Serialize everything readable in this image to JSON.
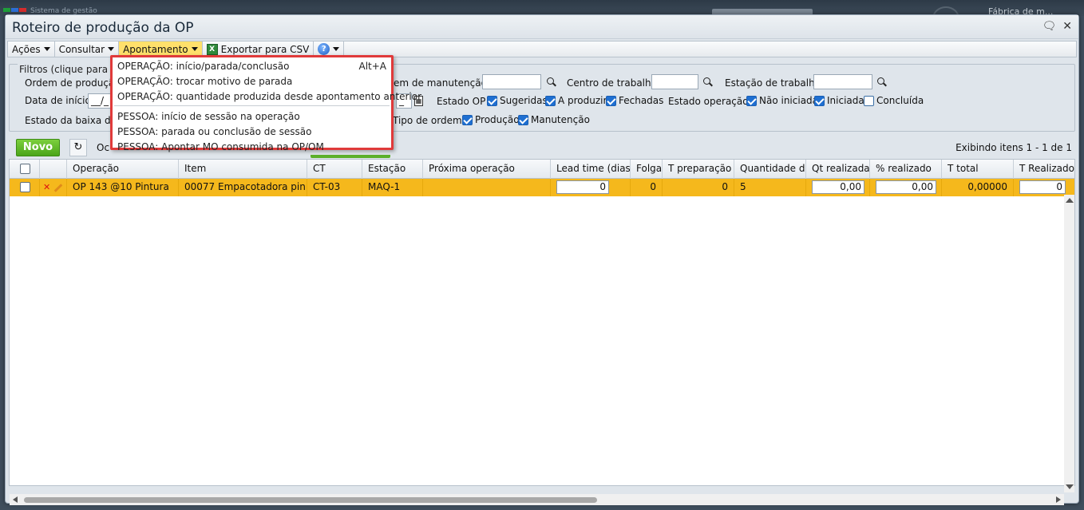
{
  "background_app": {
    "title": "Sistema de gestão",
    "right_label": "Fábrica de m...",
    "logo_colors": [
      "#1f9e3a",
      "#2d6fd6",
      "#d62d2d"
    ]
  },
  "window": {
    "title": "Roteiro de produção da OP"
  },
  "toolbar": {
    "acoes": "Ações",
    "consultar": "Consultar",
    "apontamento": "Apontamento",
    "exportar": "Exportar para CSV"
  },
  "menu": {
    "items": [
      {
        "label": "OPERAÇÃO: início/parada/conclusão",
        "shortcut": "Alt+A"
      },
      {
        "label": "OPERAÇÃO: trocar motivo de parada",
        "shortcut": ""
      },
      {
        "label": "OPERAÇÃO: quantidade produzida desde apontamento anterior",
        "shortcut": ""
      },
      {
        "label": "PESSOA: início de sessão na operação",
        "shortcut": ""
      },
      {
        "label": "PESSOA: parada ou conclusão de sessão",
        "shortcut": ""
      },
      {
        "label": "PESSOA: Apontar MO consumida na OP/OM",
        "shortcut": ""
      }
    ],
    "highlight_color": "#e03a3a"
  },
  "filters": {
    "legend": "Filtros (clique para o",
    "ordem_producao": "Ordem de produçã",
    "ordem_manutencao": "em de manutenção",
    "centro_trabalho": "Centro de trabalho",
    "estacao_trabalho": "Estação de trabalho",
    "data_inicio": "Data de início",
    "data_inicio_value": "__/_",
    "data_fim_value": "_",
    "estado_op": "Estado OP",
    "sugeridas": "Sugeridas",
    "a_produzir": "A produzir",
    "fechadas": "Fechadas",
    "estado_operacao": "Estado operação",
    "nao_iniciada": "Não iniciada",
    "iniciada": "Iniciada",
    "concluida": "Concluída",
    "estado_baixa": "Estado da baixa de",
    "tipo_ordem": "Tipo de ordem",
    "producao": "Produção",
    "manutencao": "Manutenção"
  },
  "grid_toolbar": {
    "novo": "Novo",
    "partial": "Oc",
    "count": "Exibindo itens 1 - 1 de 1"
  },
  "grid": {
    "columns": [
      "Operação",
      "Item",
      "CT",
      "Estação",
      "Próxima operação",
      "Lead time (dias)",
      "Folga",
      "T preparação",
      "Quantidade da",
      "Qt realizada",
      "% realizado",
      "T total",
      "T Realizado"
    ],
    "row": {
      "operacao": "OP 143 @10 Pintura",
      "item": "00077 Empacotadora pin...",
      "ct": "CT-03",
      "estacao": "MAQ-1",
      "proxima": "",
      "lead_time": "0",
      "folga": "0",
      "t_preparacao": "0",
      "quantidade": "5",
      "qt_realizada": "0,00",
      "pct_realizado": "0,00",
      "t_total": "0,00000",
      "t_realizado": "0"
    },
    "selected_row_color": "#f5b81c"
  }
}
